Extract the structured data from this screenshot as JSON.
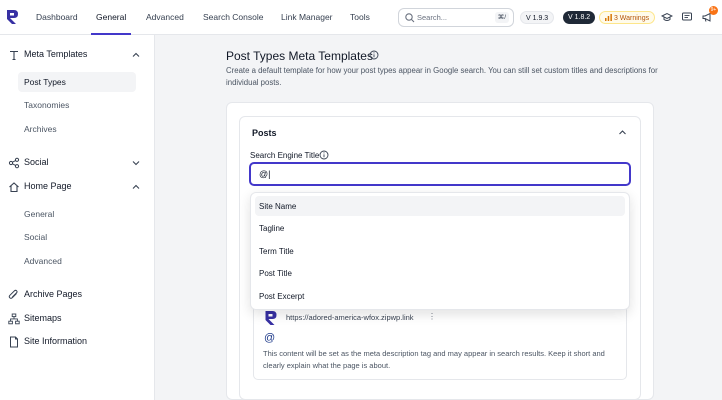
{
  "nav": {
    "tabs": [
      "Dashboard",
      "General",
      "Advanced",
      "Search Console",
      "Link Manager",
      "Tools"
    ],
    "active": "General",
    "search_placeholder": "Search...",
    "search_shortcut": "⌘/",
    "version_plugin": "V 1.9.3",
    "version_pro": "V 1.8.2",
    "warnings": "3 Warnings",
    "notification_count": "9+"
  },
  "sidebar": {
    "meta_templates": "Meta Templates",
    "post_types": "Post Types",
    "taxonomies": "Taxonomies",
    "archives": "Archives",
    "social": "Social",
    "home_page": "Home Page",
    "hp_general": "General",
    "hp_social": "Social",
    "hp_advanced": "Advanced",
    "archive_pages": "Archive Pages",
    "sitemaps": "Sitemaps",
    "site_information": "Site Information"
  },
  "main": {
    "title": "Post Types Meta Templates",
    "description": "Create a default template for how your post types appear in Google search. You can still set custom titles and descriptions for individual posts.",
    "section_title": "Posts",
    "field_label": "Search Engine Title",
    "title_value": "@|",
    "dropdown_options": [
      "Site Name",
      "Tagline",
      "Term Title",
      "Post Title",
      "Post Excerpt"
    ],
    "highlighted_option": "Site Name"
  },
  "preview": {
    "url": "https://adored-america-wfox.zipwp.link",
    "menu": "⋮",
    "title": "@",
    "description": "This content will be set as the meta description tag and may appear in search results. Keep it short and clearly explain what the page is about."
  },
  "colors": {
    "accent": "#4338ca",
    "warning_bg": "#fffbeb",
    "warning_text": "#b45309",
    "notification": "#f97316"
  }
}
